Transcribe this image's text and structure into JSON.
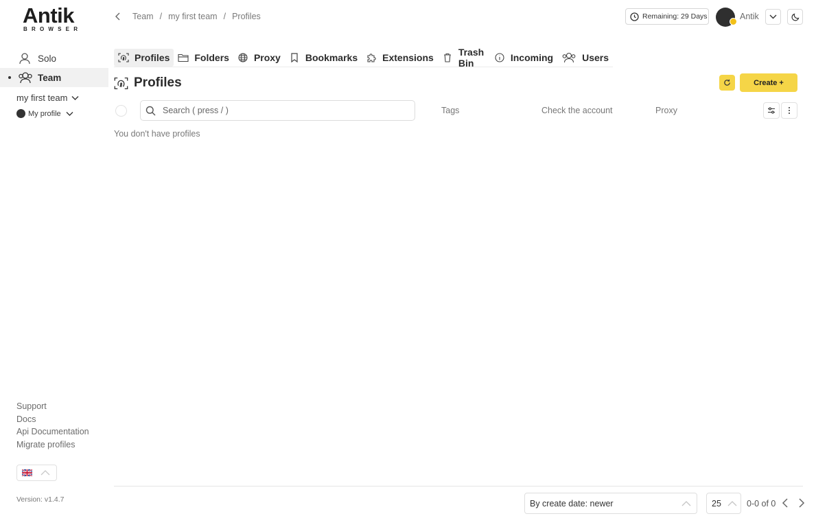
{
  "logo": {
    "word": "Antik",
    "sub": "BROWSER"
  },
  "sidebar": {
    "items": [
      {
        "label": "Solo",
        "icon": "user-icon"
      },
      {
        "label": "Team",
        "icon": "users-icon",
        "active": true
      }
    ],
    "team_select": "my first team",
    "profile_select": "My profile",
    "links": [
      "Support",
      "Docs",
      "Api Documentation",
      "Migrate profiles"
    ],
    "language": "en-GB",
    "version": "Version: v1.4.7"
  },
  "header": {
    "breadcrumb": [
      "Team",
      "/",
      "my first team",
      "/",
      "Profiles"
    ],
    "remaining": "Remaining: 29 Days",
    "user_name": "Antik"
  },
  "tabs": [
    {
      "label": "Profiles",
      "icon": "fingerprint-icon",
      "active": true
    },
    {
      "label": "Folders",
      "icon": "folder-icon"
    },
    {
      "label": "Proxy",
      "icon": "globe-icon"
    },
    {
      "label": "Bookmarks",
      "icon": "bookmark-icon"
    },
    {
      "label": "Extensions",
      "icon": "puzzle-icon"
    },
    {
      "label": "Trash Bin",
      "icon": "trash-icon"
    },
    {
      "label": "Incoming",
      "icon": "info-icon"
    },
    {
      "label": "Users",
      "icon": "users-icon"
    }
  ],
  "main": {
    "title": "Profiles",
    "create_label": "Create +",
    "search_placeholder": "Search ( press / )",
    "columns": [
      "Tags",
      "Check the account",
      "Proxy"
    ],
    "empty_message": "You don't have profiles"
  },
  "footer": {
    "sort_value": "By create date: newer",
    "page_size": "25",
    "range": "0-0 of 0"
  },
  "colors": {
    "accent": "#f5d547",
    "active_bg": "#efefef",
    "muted_text": "#7a7a7a"
  }
}
